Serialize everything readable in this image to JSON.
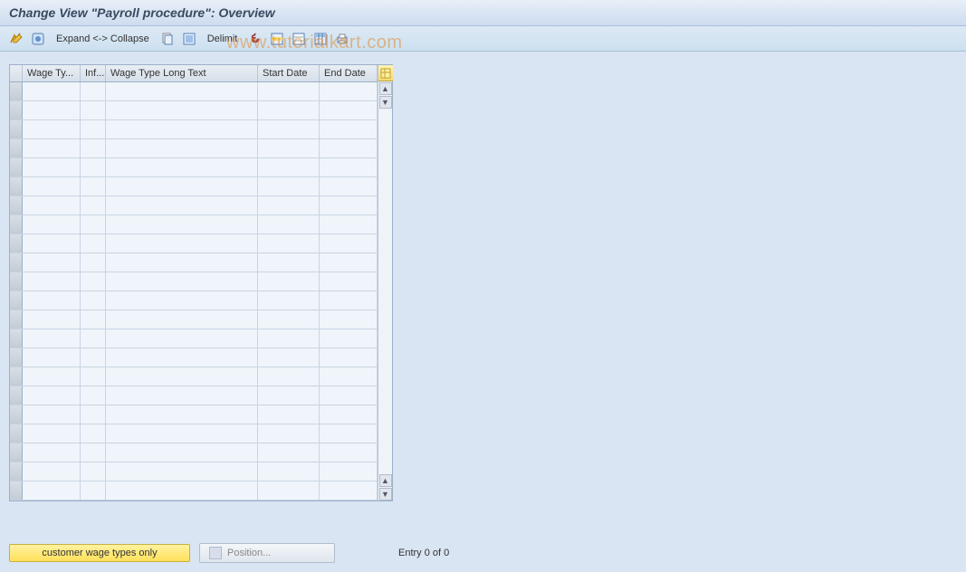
{
  "title": "Change View \"Payroll procedure\": Overview",
  "toolbar": {
    "expand_collapse_label": "Expand <-> Collapse",
    "delimit_label": "Delimit"
  },
  "grid": {
    "columns": [
      {
        "key": "wage_type",
        "label": "Wage Ty..."
      },
      {
        "key": "inf",
        "label": "Inf..."
      },
      {
        "key": "long_text",
        "label": "Wage Type Long Text"
      },
      {
        "key": "start_date",
        "label": "Start Date"
      },
      {
        "key": "end_date",
        "label": "End Date"
      }
    ],
    "rows": [
      {},
      {},
      {},
      {},
      {},
      {},
      {},
      {},
      {},
      {},
      {},
      {},
      {},
      {},
      {},
      {},
      {},
      {},
      {},
      {},
      {},
      {}
    ]
  },
  "footer": {
    "customer_wage_types_label": "customer wage types only",
    "position_label": "Position...",
    "entry_text": "Entry 0 of 0"
  },
  "watermark": "www.tutorialkart.com"
}
